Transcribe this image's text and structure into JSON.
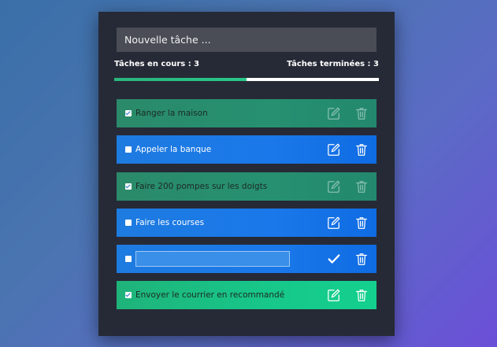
{
  "new_task": {
    "placeholder": "Nouvelle tâche ..."
  },
  "stats": {
    "in_progress_label": "Tâches en cours : 3",
    "done_label": "Tâches terminées : 3",
    "progress_fraction": 0.5
  },
  "todos": [
    {
      "label": "Ranger la maison",
      "done": true,
      "style": "done"
    },
    {
      "label": "Appeler la banque",
      "done": false,
      "style": "pending"
    },
    {
      "label": "Faire 200 pompes sur les doigts",
      "done": true,
      "style": "done"
    },
    {
      "label": "Faire les courses",
      "done": false,
      "style": "pending"
    },
    {
      "label": "",
      "done": false,
      "style": "editing"
    },
    {
      "label": "Envoyer le courrier en recommandé",
      "done": true,
      "style": "done-bright"
    }
  ],
  "icons": {
    "edit": "pencil-square-icon",
    "delete": "trash-icon",
    "confirm": "checkmark-icon"
  },
  "colors": {
    "card": "#262a36",
    "done_row": "#2a8a6a",
    "pending_row": "#1e7be0",
    "done_bright_row": "#17c88a",
    "progress": "#2ab57d"
  }
}
